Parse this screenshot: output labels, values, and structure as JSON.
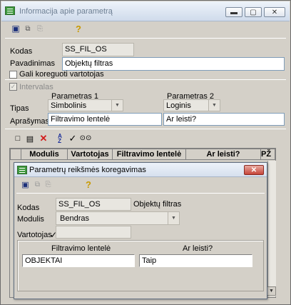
{
  "main_window": {
    "title": "Informacija apie parametrą",
    "fields": {
      "kodas_label": "Kodas",
      "kodas_value": "SS_FIL_OS",
      "pavadinimas_label": "Pavadinimas",
      "pavadinimas_value": "Objektų filtras",
      "gali_label": "Gali koreguoti vartotojas",
      "intervalas_label": "Intervalas",
      "param1_header": "Parametras 1",
      "param2_header": "Parametras 2",
      "tipas_label": "Tipas",
      "tipas1_value": "Simbolinis",
      "tipas2_value": "Loginis",
      "aprasymas_label": "Aprašymas",
      "aprasymas1_value": "Filtravimo lentelė",
      "aprasymas2_value": "Ar leisti?"
    },
    "grid": {
      "columns": [
        "Modulis",
        "Vartotojas",
        "Filtravimo lentelė",
        "Ar leisti?",
        "PŽ"
      ]
    }
  },
  "dialog": {
    "title": "Parametrų reikšmės koregavimas",
    "kodas_label": "Kodas",
    "kodas_value": "SS_FIL_OS",
    "kodas_desc": "Objektų filtras",
    "modulis_label": "Modulis",
    "modulis_value": "Bendras",
    "vartotojas_label": "Vartotojas",
    "vartotojas_check": "✓",
    "col1_header": "Filtravimo lentelė",
    "col2_header": "Ar leisti?",
    "col1_value": "OBJEKTAI",
    "col2_value": "Taip"
  },
  "icons": {
    "save": "💾",
    "help": "?",
    "new": "🗋",
    "close": "✕",
    "sort": "A↓Z",
    "check": "✓",
    "binoculars": "👁"
  },
  "colors": {
    "accent_green": "#3f9a3f",
    "close_red": "#c6453a"
  }
}
